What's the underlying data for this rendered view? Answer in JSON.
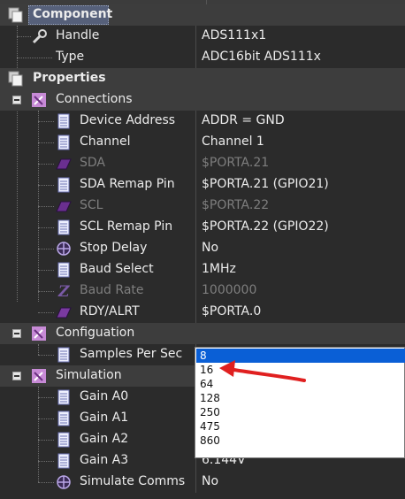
{
  "sections": {
    "component": "Component",
    "properties": "Properties"
  },
  "rows": {
    "handle": {
      "label": "Handle",
      "value": "ADS111x1"
    },
    "type": {
      "label": "Type",
      "value": "ADC16bit  ADS111x"
    },
    "connections": "Connections",
    "device_address": {
      "label": "Device Address",
      "value": "ADDR = GND"
    },
    "channel": {
      "label": "Channel",
      "value": "Channel 1"
    },
    "sda": {
      "label": "SDA",
      "value": "$PORTA.21"
    },
    "sda_remap": {
      "label": "SDA Remap Pin",
      "value": "$PORTA.21 (GPIO21)"
    },
    "scl": {
      "label": "SCL",
      "value": "$PORTA.22"
    },
    "scl_remap": {
      "label": "SCL Remap Pin",
      "value": "$PORTA.22 (GPIO22)"
    },
    "stop_delay": {
      "label": "Stop Delay",
      "value": "No"
    },
    "baud_select": {
      "label": "Baud Select",
      "value": "1MHz"
    },
    "baud_rate": {
      "label": "Baud Rate",
      "value": "1000000"
    },
    "rdy_alrt": {
      "label": "RDY/ALRT",
      "value": "$PORTA.0"
    },
    "configuation": "Configuation",
    "samples_per_sec": {
      "label": "Samples Per Sec"
    },
    "simulation": "Simulation",
    "gain_a0": {
      "label": "Gain A0"
    },
    "gain_a1": {
      "label": "Gain A1"
    },
    "gain_a2": {
      "label": "Gain A2"
    },
    "gain_a3": {
      "label": "Gain A3",
      "value": "6.144V"
    },
    "simulate_comms": {
      "label": "Simulate Comms",
      "value": "No"
    }
  },
  "dropdown": {
    "options": [
      "8",
      "16",
      "64",
      "128",
      "250",
      "475",
      "860"
    ],
    "selected": "8"
  },
  "colors": {
    "background": "#2b2b2b",
    "category_row": "#3d3d3d",
    "selection": "#0a5fd6",
    "annotation_arrow": "#e02020"
  }
}
